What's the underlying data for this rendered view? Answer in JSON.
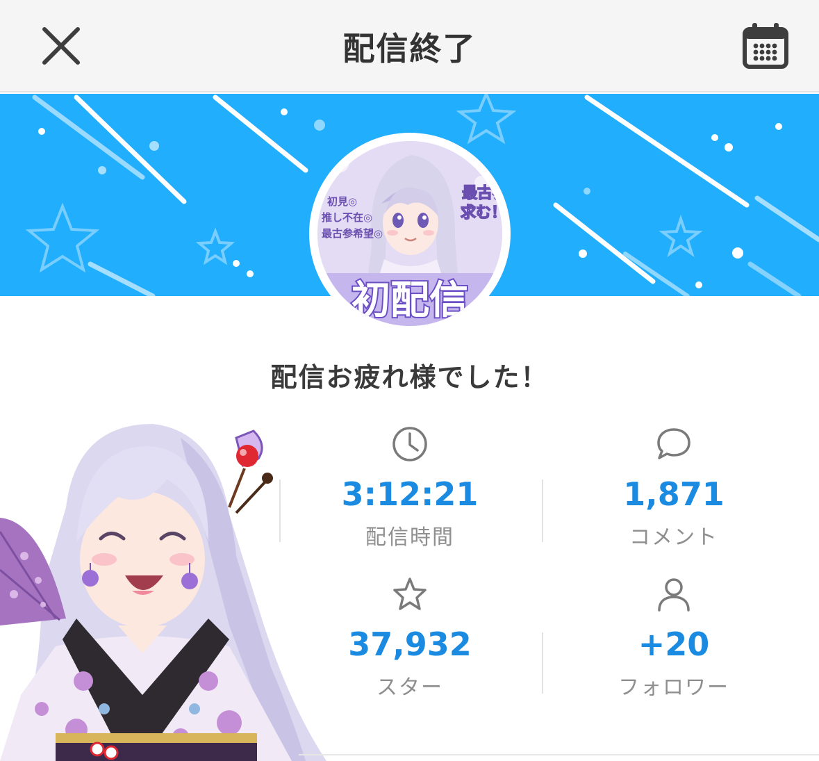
{
  "header": {
    "title": "配信終了",
    "close_icon": "close-icon",
    "calendar_icon": "calendar-icon"
  },
  "avatar": {
    "text_lines": [
      "初見◎",
      "推し不在◎",
      "最古参希望◎"
    ],
    "side_text": [
      "最古参",
      "求む！"
    ],
    "big_text": "初配信"
  },
  "message": "配信お疲れ様でした！",
  "stats": {
    "duration": {
      "icon": "clock-icon",
      "value": "3:12:21",
      "label": "配信時間"
    },
    "comments": {
      "icon": "comment-icon",
      "value": "1,871",
      "label": "コメント"
    },
    "stars": {
      "icon": "star-icon",
      "value": "37,932",
      "label": "スター"
    },
    "followers": {
      "icon": "person-icon",
      "value": "+20",
      "label": "フォロワー"
    }
  },
  "colors": {
    "banner": "#21aefd",
    "accent": "#1a8be0",
    "header_bg": "#f5f5f6"
  }
}
